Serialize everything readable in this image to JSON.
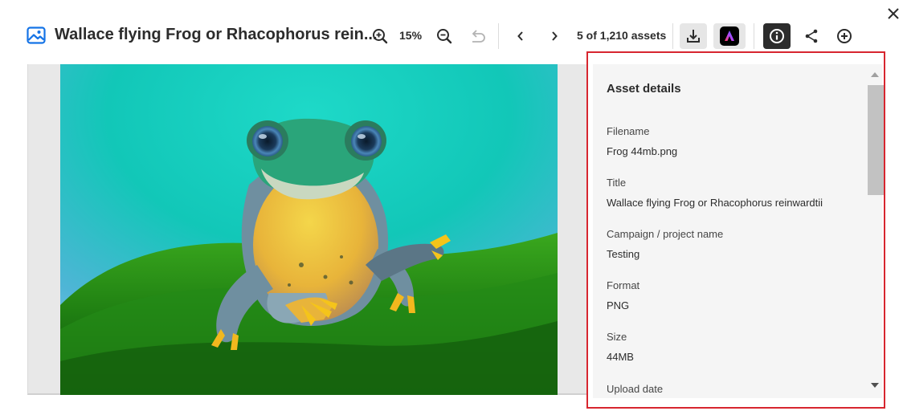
{
  "header": {
    "title": "Wallace flying Frog or Rhacophorus rein...",
    "zoom_level": "15%",
    "counter": "5 of 1,210 assets"
  },
  "icons": {
    "app": "image-icon",
    "zoom_in": "zoom-in-icon",
    "zoom_out": "zoom-out-icon",
    "reset": "undo-icon",
    "previous": "chevron-left-icon",
    "next": "chevron-right-icon",
    "download": "download-icon",
    "express": "adobe-express-icon",
    "info": "info-icon",
    "share": "share-icon",
    "add": "add-circle-icon",
    "close": "close-icon"
  },
  "details": {
    "heading": "Asset details",
    "fields": [
      {
        "label": "Filename",
        "value": "Frog 44mb.png"
      },
      {
        "label": "Title",
        "value": "Wallace flying Frog or Rhacophorus reinwardtii"
      },
      {
        "label": "Campaign / project name",
        "value": "Testing"
      },
      {
        "label": "Format",
        "value": "PNG"
      },
      {
        "label": "Size",
        "value": "44MB"
      },
      {
        "label": "Upload date",
        "value": ""
      }
    ]
  },
  "colors": {
    "accent_blue": "#1473e6",
    "highlight_border": "#d7262f",
    "active_button": "#2c2c2c"
  }
}
